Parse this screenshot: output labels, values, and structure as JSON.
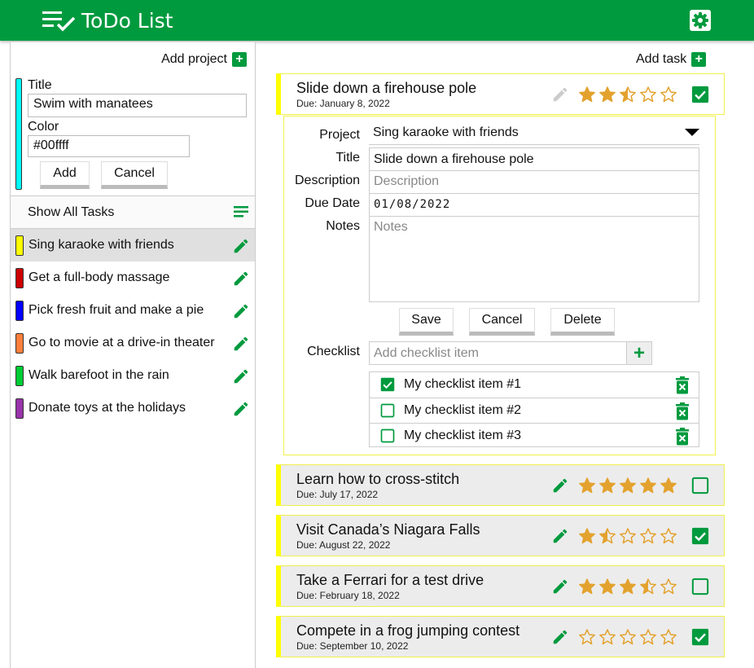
{
  "app": {
    "title": "ToDo List",
    "logo_icon": "checklist-icon",
    "settings_icon": "gear-icon"
  },
  "colors": {
    "brand": "#009a3e",
    "star": "#e3a22e",
    "task_accent": "#ffff00"
  },
  "sidebar": {
    "add_project_label": "Add project",
    "form": {
      "title_label": "Title",
      "title_value": "Swim with manatees",
      "color_label": "Color",
      "color_value": "#00ffff",
      "add_label": "Add",
      "cancel_label": "Cancel"
    },
    "show_all_label": "Show All Tasks",
    "projects": [
      {
        "label": "Sing karaoke with friends",
        "color": "#ffff00"
      },
      {
        "label": "Get a full-body massage",
        "color": "#cc0000"
      },
      {
        "label": "Pick fresh fruit and make a pie",
        "color": "#0000ff"
      },
      {
        "label": "Go to movie at a drive-in theater",
        "color": "#ff7f3a"
      },
      {
        "label": "Walk barefoot in the rain",
        "color": "#00cc33"
      },
      {
        "label": "Donate toys at the holidays",
        "color": "#9933aa"
      }
    ]
  },
  "main": {
    "add_task_label": "Add task",
    "tasks": [
      {
        "title": "Slide down a firehouse pole",
        "due": "Due: January 8, 2022",
        "rating": 2.5,
        "done": true
      },
      {
        "title": "Learn how to cross-stitch",
        "due": "Due: July 17, 2022",
        "rating": 5,
        "done": false
      },
      {
        "title": "Visit Canada’s Niagara Falls",
        "due": "Due: August 22, 2022",
        "rating": 1.5,
        "done": true
      },
      {
        "title": "Take a Ferrari for a test drive",
        "due": "Due: February 18, 2022",
        "rating": 3.5,
        "done": false
      },
      {
        "title": "Compete in a frog jumping contest",
        "due": "Due: September 10, 2022",
        "rating": 0,
        "done": true
      }
    ],
    "detail": {
      "project_label": "Project",
      "project_value": "Sing karaoke with friends",
      "title_label": "Title",
      "title_value": "Slide down a firehouse pole",
      "description_label": "Description",
      "description_placeholder": "Description",
      "due_label": "Due Date",
      "due_value": "01/08/2022",
      "notes_label": "Notes",
      "notes_placeholder": "Notes",
      "save_label": "Save",
      "cancel_label": "Cancel",
      "delete_label": "Delete",
      "checklist_label": "Checklist",
      "checklist_placeholder": "Add checklist item",
      "checklist": [
        {
          "label": "My checklist item #1",
          "checked": true
        },
        {
          "label": "My checklist item #2",
          "checked": false
        },
        {
          "label": "My checklist item #3",
          "checked": false
        }
      ]
    }
  }
}
